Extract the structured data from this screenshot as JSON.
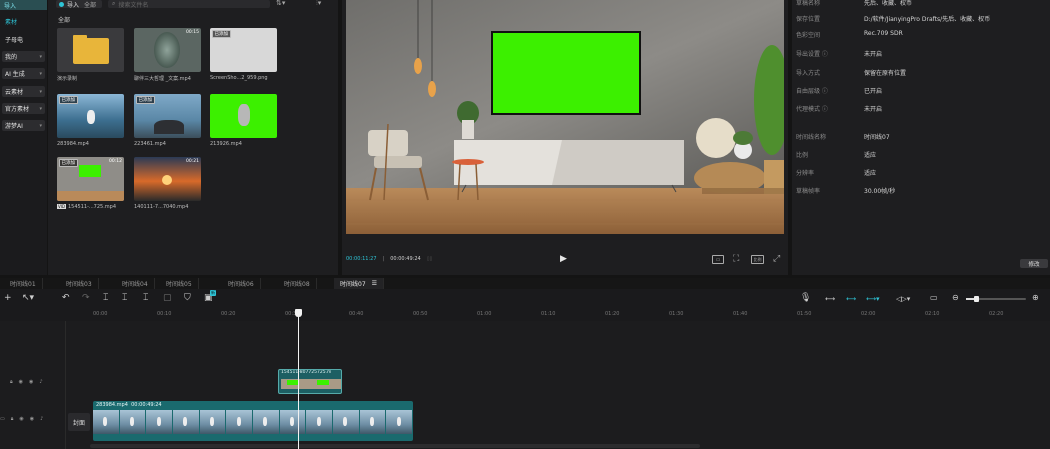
{
  "leftnav": {
    "import_label": "导入",
    "items": [
      {
        "label": "素材",
        "boxed": false,
        "active": true,
        "dropdown": false
      },
      {
        "label": "子母电",
        "boxed": false,
        "active": false,
        "dropdown": false
      },
      {
        "label": "我的",
        "boxed": true,
        "active": false,
        "dropdown": true
      },
      {
        "label": "AI 生成",
        "boxed": true,
        "active": false,
        "dropdown": true
      },
      {
        "label": "云素材",
        "boxed": true,
        "active": false,
        "dropdown": true
      },
      {
        "label": "官方素材",
        "boxed": true,
        "active": false,
        "dropdown": true
      },
      {
        "label": "游梦AI",
        "boxed": true,
        "active": false,
        "dropdown": true
      }
    ]
  },
  "media": {
    "import_button": "导入",
    "all_tag": "全部",
    "search_placeholder": "搜索文件名",
    "section_label": "全部",
    "items": [
      {
        "label": "演示录制",
        "kind": "folder",
        "badge": "",
        "duration": ""
      },
      {
        "label": "聊伴三大哲理 _文案.mp4",
        "kind": "coin",
        "badge": "",
        "duration": "00:15"
      },
      {
        "label": "ScreenSho...2_959.png",
        "kind": "white",
        "badge": "已添加",
        "duration": ""
      },
      {
        "label": "283984.mp4",
        "kind": "bird",
        "badge": "已添加",
        "duration": ""
      },
      {
        "label": "223461.mp4",
        "kind": "birdrock",
        "badge": "已添加",
        "duration": ""
      },
      {
        "label": "213926.mp4",
        "kind": "greenbird",
        "badge": "",
        "duration": ""
      },
      {
        "label": "154511-...725.mp4",
        "kind": "room",
        "badge": "已添加",
        "duration": "00:12",
        "prefix": "VID"
      },
      {
        "label": "140111-7...7040.mp4",
        "kind": "sunset",
        "badge": "",
        "duration": "00:21"
      }
    ]
  },
  "player": {
    "current_time": "00:00:11:27",
    "total_time": "00:00:49:24",
    "ratio_label": "比例"
  },
  "props": {
    "rows": [
      {
        "k": "草稿名称",
        "v": "先后、收藏、权币"
      },
      {
        "k": "保存位置",
        "v": "D:/软件/JianyingPro Drafts/先后、收藏、权币"
      },
      {
        "k": "色彩空间",
        "v": "Rec.709 SDR"
      },
      {
        "k": "导出设置 ⓘ",
        "v": "未开启"
      },
      {
        "k": "导入方式",
        "v": "保留在原有位置"
      },
      {
        "k": "自由层级 ⓘ",
        "v": "已开启"
      },
      {
        "k": "代理模式 ⓘ",
        "v": "未开启"
      },
      {
        "k": "时间线名称",
        "v": "时间线07"
      },
      {
        "k": "比例",
        "v": "适应"
      },
      {
        "k": "分辨率",
        "v": "适应"
      },
      {
        "k": "草稿帧率",
        "v": "30.00帧/秒"
      }
    ],
    "modify_button": "修改"
  },
  "tabs": [
    "时间线01",
    "时间线03",
    "时间线04",
    "时间线05",
    "时间线06",
    "时间线08",
    "时间线07"
  ],
  "active_tab_index": 6,
  "toolbar": {
    "new_badge": "新"
  },
  "ruler": [
    "00:00",
    "00:10",
    "00:20",
    "00:30",
    "00:40",
    "00:50",
    "01:00",
    "01:10",
    "01:20",
    "01:30",
    "01:40",
    "01:50",
    "02:00",
    "02:10",
    "02:20"
  ],
  "timeline": {
    "cover_label": "封面",
    "clip_main_label": "283984.mp4",
    "clip_main_duration": "00:00:49:24",
    "clip_overlay_label": "154511-807725725.m"
  }
}
